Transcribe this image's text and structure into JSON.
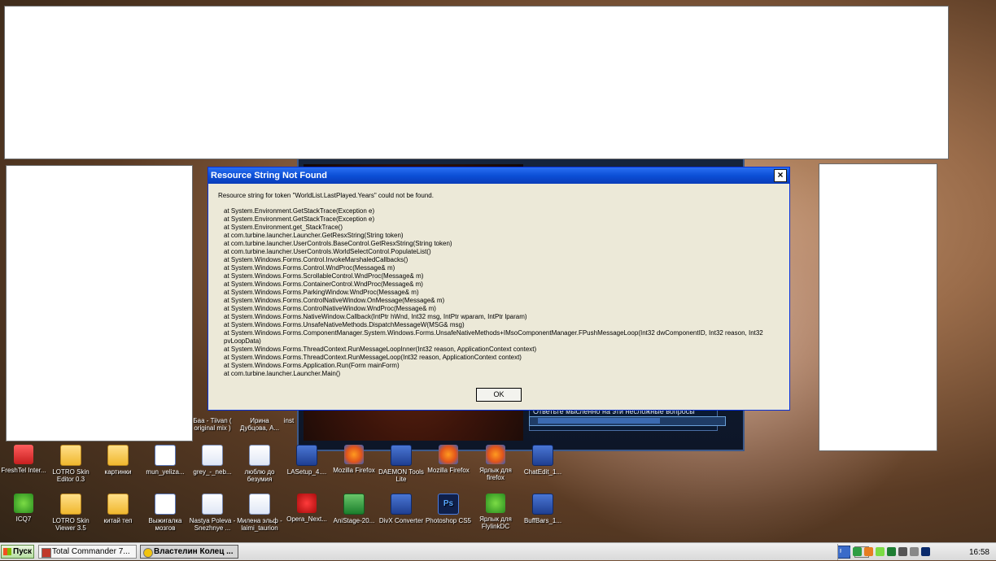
{
  "dialog": {
    "title": "Resource String Not Found",
    "close_glyph": "×",
    "message": "Resource string for token \"WorldList.LastPlayed.Years\" could not be found.",
    "stack_trace": [
      "at System.Environment.GetStackTrace(Exception e)",
      "at System.Environment.GetStackTrace(Exception e)",
      "at System.Environment.get_StackTrace()",
      "at com.turbine.launcher.Launcher.GetResxString(String token)",
      "at com.turbine.launcher.UserControls.BaseControl.GetResxString(String token)",
      "at com.turbine.launcher.UserControls.WorldSelectControl.PopulateList()",
      "at System.Windows.Forms.Control.InvokeMarshaledCallbacks()",
      "at System.Windows.Forms.Control.WndProc(Message& m)",
      "at System.Windows.Forms.ScrollableControl.WndProc(Message& m)",
      "at System.Windows.Forms.ContainerControl.WndProc(Message& m)",
      "at System.Windows.Forms.ParkingWindow.WndProc(Message& m)",
      "at System.Windows.Forms.ControlNativeWindow.OnMessage(Message& m)",
      "at System.Windows.Forms.ControlNativeWindow.WndProc(Message& m)",
      "at System.Windows.Forms.NativeWindow.Callback(IntPtr hWnd, Int32 msg, IntPtr wparam, IntPtr lparam)",
      "at System.Windows.Forms.UnsafeNativeMethods.DispatchMessageW(MSG& msg)",
      "at System.Windows.Forms.ComponentManager.System.Windows.Forms.UnsafeNativeMethods+IMsoComponentManager.FPushMessageLoop(Int32 dwComponentID, Int32 reason, Int32 pvLoopData)",
      "at System.Windows.Forms.ThreadContext.RunMessageLoopInner(Int32 reason, ApplicationContext context)",
      "at System.Windows.Forms.ThreadContext.RunMessageLoop(Int32 reason, ApplicationContext context)",
      "at System.Windows.Forms.Application.Run(Form mainForm)",
      "at com.turbine.launcher.Launcher.Main()"
    ],
    "ok_label": "OK"
  },
  "game_window": {
    "list_text": "Ответьте мысленно на эти несложные вопросы"
  },
  "desktop_icons": {
    "row1": [
      {
        "label": "FreshTel Inter...",
        "icon": "red"
      },
      {
        "label": "LOTRO Skin Editor 0.3",
        "icon": "folder"
      },
      {
        "label": "картинки",
        "icon": "folder"
      },
      {
        "label": "mun_yeliza...",
        "icon": "doc"
      },
      {
        "label": "grey_-_neb...",
        "icon": "mp3"
      },
      {
        "label": "люблю до безумия",
        "icon": "mp3"
      },
      {
        "label": "LASetup_4....",
        "icon": "app"
      },
      {
        "label": "Mozilla Firefox",
        "icon": "ff"
      },
      {
        "label": "DAEMON Tools Lite",
        "icon": "app"
      },
      {
        "label": "Mozilla Firefox",
        "icon": "ff"
      },
      {
        "label": "Ярлык для firefox",
        "icon": "ff"
      },
      {
        "label": "ChatEdit_1...",
        "icon": "app"
      }
    ],
    "row2": [
      {
        "label": "ICQ7",
        "icon": "green"
      },
      {
        "label": "LOTRO Skin Viewer 3.5",
        "icon": "folder"
      },
      {
        "label": "китай теп",
        "icon": "folder"
      },
      {
        "label": "Выжигалка мозгов",
        "icon": "doc"
      },
      {
        "label": "Nastya Poleva - Snezhnye ...",
        "icon": "mp3"
      },
      {
        "label": "Милена эльф - laimi_taurion",
        "icon": "mp3"
      },
      {
        "label": "Opera_Next...",
        "icon": "opera"
      },
      {
        "label": "AniStage-20...",
        "icon": "excel"
      },
      {
        "label": "DivX Converter",
        "icon": "app"
      },
      {
        "label": "Photoshop CS5",
        "icon": "ps"
      },
      {
        "label": "Ярлык для FlylinkDC",
        "icon": "green"
      },
      {
        "label": "BuffBars_1...",
        "icon": "app"
      }
    ],
    "partial": [
      {
        "label": "Баа - Tiivan ( original mix )"
      },
      {
        "label": "Ирина Дубцова, А..."
      },
      {
        "label": "inst"
      }
    ]
  },
  "taskbar": {
    "start_label": "Пуск",
    "tasks": [
      {
        "label": "Total Commander 7...",
        "active": false
      },
      {
        "label": "Властелин Колец ...",
        "active": true
      }
    ],
    "lang": "RU",
    "clock": "16:58"
  }
}
